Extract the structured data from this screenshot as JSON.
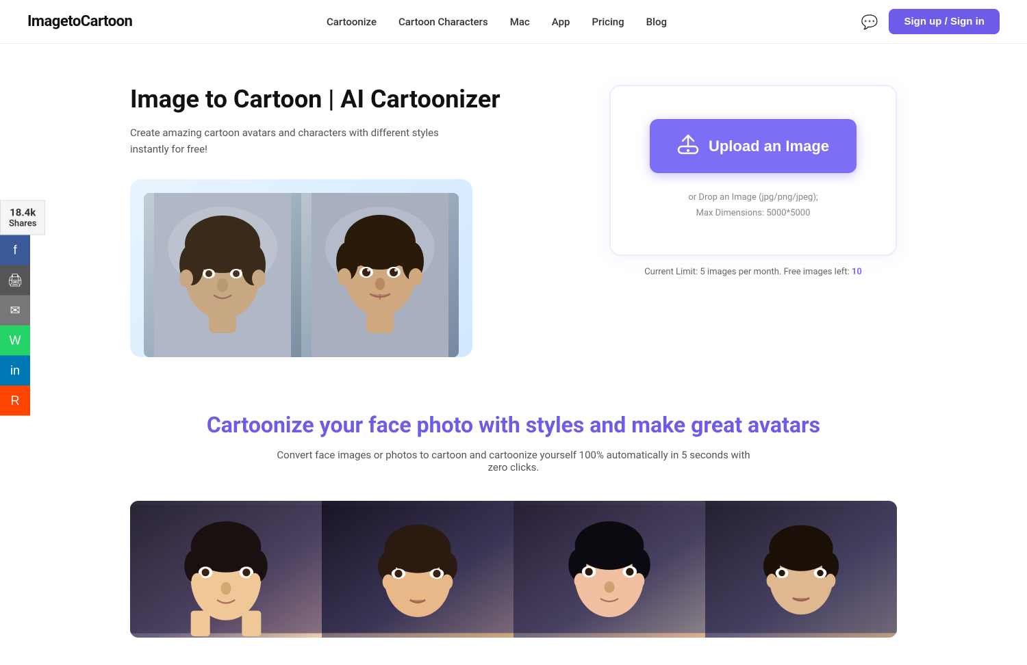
{
  "brand": {
    "name": "ImagetoCartoon"
  },
  "nav": {
    "links": [
      {
        "label": "Cartoonize",
        "id": "cartoonize"
      },
      {
        "label": "Cartoon Characters",
        "id": "cartoon-characters"
      },
      {
        "label": "Mac",
        "id": "mac"
      },
      {
        "label": "App",
        "id": "app"
      },
      {
        "label": "Pricing",
        "id": "pricing"
      },
      {
        "label": "Blog",
        "id": "blog"
      }
    ],
    "signup_label": "Sign up / Sign in"
  },
  "social": {
    "count": "18.4k",
    "count_label": "Shares"
  },
  "hero": {
    "title": "Image to Cartoon | AI Cartoonizer",
    "description": "Create amazing cartoon avatars and characters with different styles instantly for free!"
  },
  "upload": {
    "button_label": "Upload an Image",
    "hint_line1": "or Drop an Image (jpg/png/jpeg);",
    "hint_line2": "Max Dimensions: 5000*5000"
  },
  "limit": {
    "text": "Current Limit: 5 images per month. Free images left:",
    "number": "10"
  },
  "bottom": {
    "title": "Cartoonize your face photo with styles and make great avatars",
    "description": "Convert face images or photos to cartoon and cartoonize yourself 100% automatically in 5 seconds with zero clicks."
  }
}
